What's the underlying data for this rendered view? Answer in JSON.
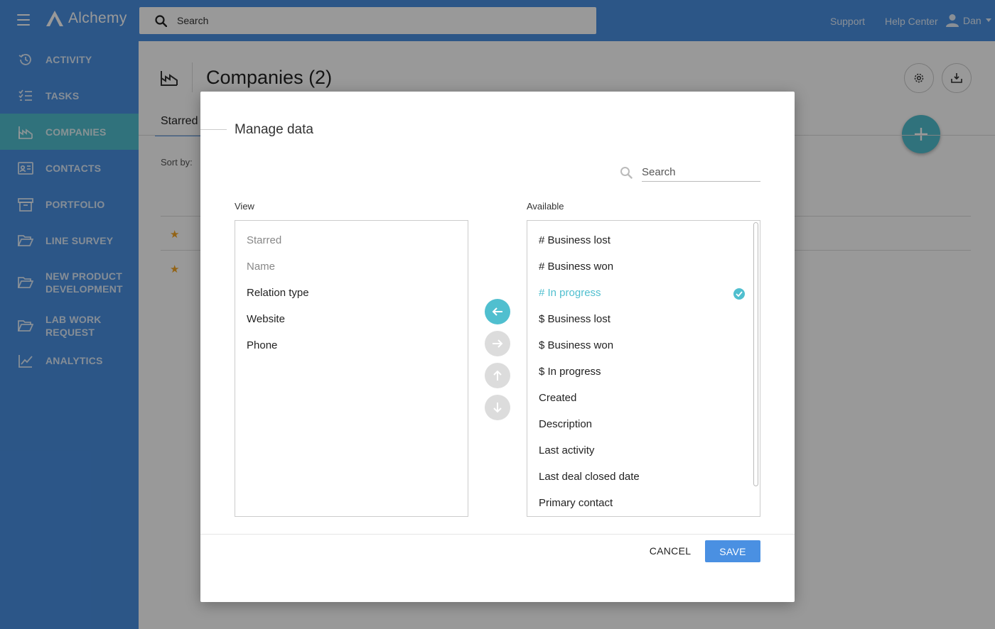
{
  "app": {
    "name": "Alchemy"
  },
  "topbar": {
    "search_placeholder": "Search",
    "links": [
      "Support",
      "Help Center"
    ],
    "user": "Dan"
  },
  "sidebar": {
    "items": [
      {
        "label": "ACTIVITY",
        "icon": "history-icon"
      },
      {
        "label": "TASKS",
        "icon": "checklist-icon"
      },
      {
        "label": "COMPANIES",
        "icon": "factory-icon",
        "active": true
      },
      {
        "label": "CONTACTS",
        "icon": "contact-card-icon"
      },
      {
        "label": "PORTFOLIO",
        "icon": "archive-box-icon"
      },
      {
        "label": "LINE SURVEY",
        "icon": "folder-open-icon"
      },
      {
        "label": "NEW PRODUCT DEVELOPMENT",
        "icon": "folder-open-icon"
      },
      {
        "label": "LAB WORK REQUEST",
        "icon": "folder-open-icon"
      },
      {
        "label": "ANALYTICS",
        "icon": "trend-chart-icon"
      }
    ]
  },
  "main": {
    "title": "Companies (2)",
    "tab": "Starred",
    "sort_label": "Sort by:"
  },
  "modal": {
    "title": "Manage data",
    "search_placeholder": "Search",
    "view_label": "View",
    "available_label": "Available",
    "view_items": [
      {
        "label": "Starred",
        "locked": true
      },
      {
        "label": "Name",
        "locked": true
      },
      {
        "label": "Relation type"
      },
      {
        "label": "Website"
      },
      {
        "label": "Phone"
      }
    ],
    "available_items": [
      {
        "label": "# Business lost"
      },
      {
        "label": "# Business won"
      },
      {
        "label": "# In progress",
        "selected": true
      },
      {
        "label": "$ Business lost"
      },
      {
        "label": "$ Business won"
      },
      {
        "label": "$ In progress"
      },
      {
        "label": "Created"
      },
      {
        "label": "Description"
      },
      {
        "label": "Last activity"
      },
      {
        "label": "Last deal closed date"
      },
      {
        "label": "Primary contact"
      }
    ],
    "cancel_label": "CANCEL",
    "save_label": "SAVE"
  },
  "colors": {
    "brand": "#4a90e2",
    "accent": "#50bfcf",
    "star": "#f5a623"
  }
}
